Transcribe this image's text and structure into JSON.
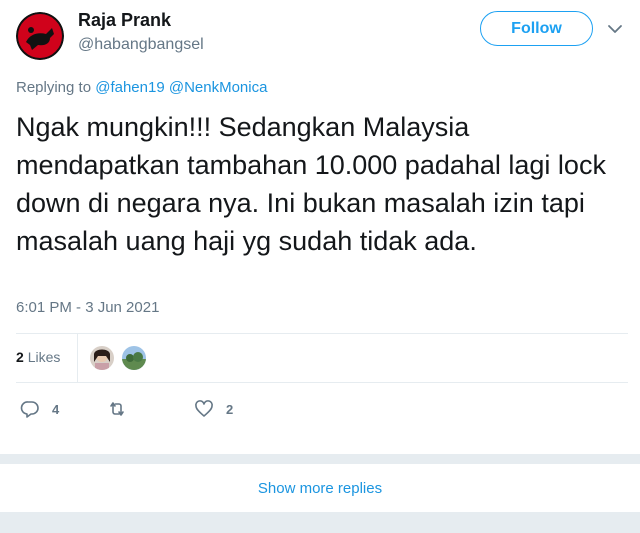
{
  "tweet": {
    "author": {
      "name": "Raja Prank",
      "handle": "@habangbangsel"
    },
    "follow_label": "Follow",
    "replying_to": {
      "prefix": "Replying to",
      "mentions": [
        "@fahen19",
        "@NenkMonica"
      ]
    },
    "text": "Ngak mungkin!!! Sedangkan Malaysia mendapatkan tambahan 10.000 padahal lagi lock down di negara nya. Ini bukan masalah izin tapi masalah uang haji yg sudah tidak ada.",
    "timestamp": "6:01 PM - 3 Jun 2021",
    "likes": {
      "count": "2",
      "label": "Likes"
    },
    "actions": {
      "replies": "4",
      "retweets": "",
      "likes": "2"
    }
  },
  "show_more_label": "Show more replies",
  "colors": {
    "accent": "#1da1f2",
    "link": "#1b95e0",
    "muted": "#657786",
    "divider": "#e6ecf0"
  },
  "icons": [
    "chevron-down-icon",
    "reply-icon",
    "retweet-icon",
    "heart-icon"
  ]
}
